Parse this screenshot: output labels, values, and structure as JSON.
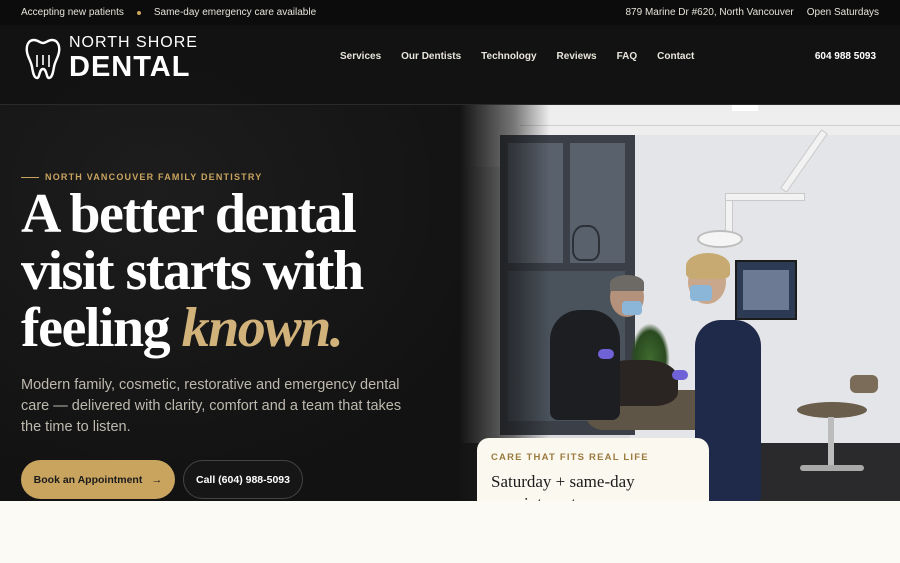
{
  "topbar": {
    "left": [
      "Accepting new patients",
      "Same-day emergency care available"
    ],
    "address": "879 Marine Dr #620, North Vancouver",
    "hours": "Open Saturdays"
  },
  "logo": {
    "line1": "NORTH SHORE",
    "line2": "DENTAL"
  },
  "nav": {
    "items": [
      "Services",
      "Our Dentists",
      "Technology",
      "Reviews",
      "FAQ",
      "Contact"
    ]
  },
  "header": {
    "phone": "604 988 5093"
  },
  "hero": {
    "eyebrow": "NORTH VANCOUVER FAMILY DENTISTRY",
    "headline_1": "A better dental",
    "headline_2": "visit starts with",
    "headline_3": "feeling ",
    "headline_accent": "known.",
    "subtext": "Modern family, cosmetic, restorative and emergency dental care — delivered with clarity, comfort and a team that takes the time to listen.",
    "cta_primary": "Book an Appointment",
    "cta_primary_icon": "arrow-right-icon",
    "cta_secondary": "Call (604) 988-5093"
  },
  "card": {
    "kicker": "CARE THAT FITS REAL LIFE",
    "title_1": "Saturday + same-day",
    "title_2": "appointments"
  },
  "colors": {
    "accent": "#c9a45f",
    "dark": "#141414",
    "cream": "#fbfaf4"
  }
}
